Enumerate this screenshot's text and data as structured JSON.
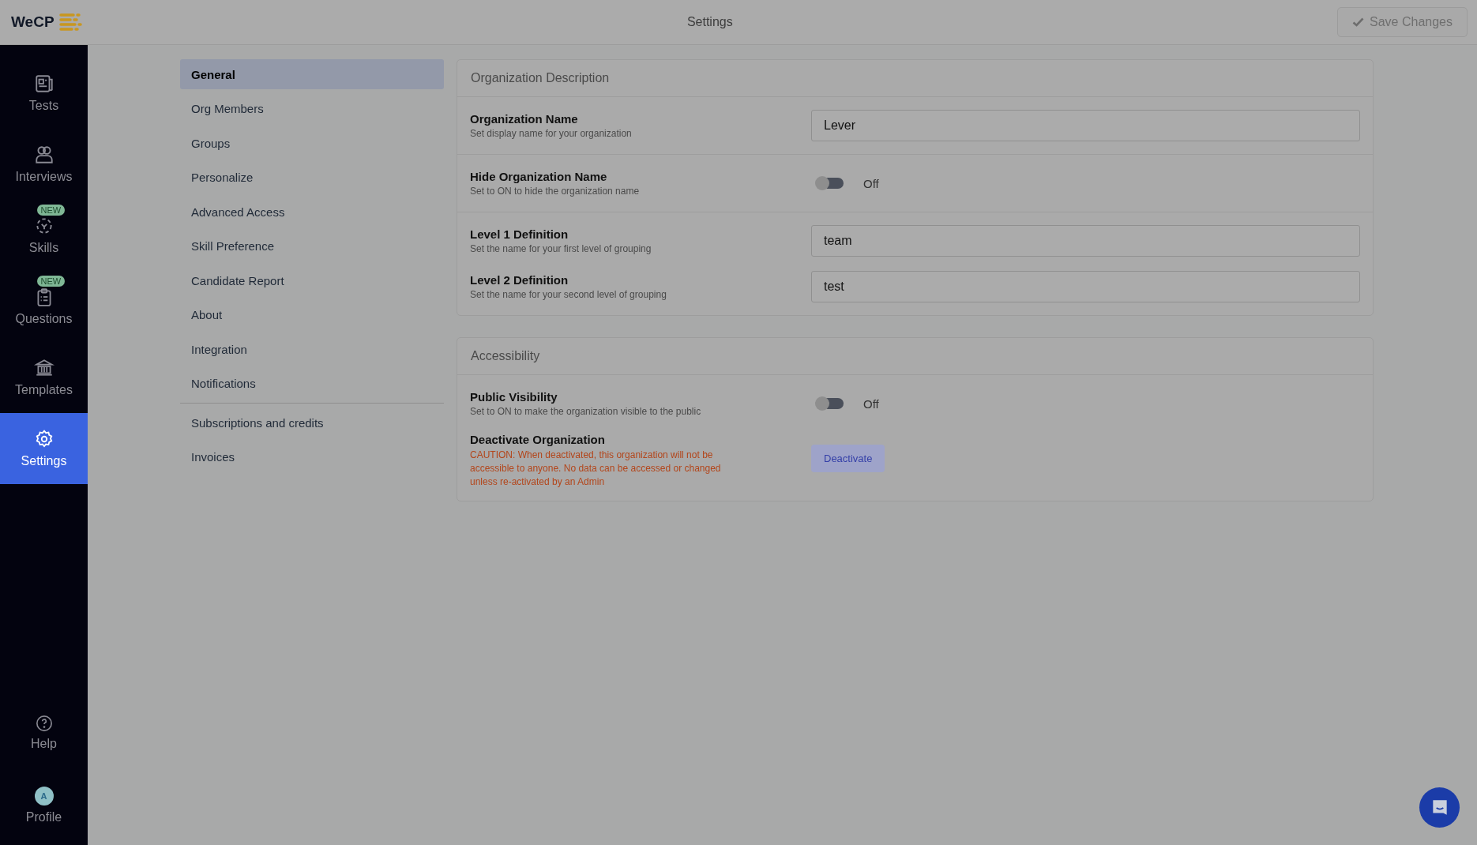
{
  "header": {
    "logo": "WeCP",
    "title": "Settings",
    "save_button": "Save Changes"
  },
  "sidebar": {
    "items": [
      {
        "label": "Tests",
        "selected": false
      },
      {
        "label": "Interviews",
        "selected": false
      },
      {
        "label": "Skills",
        "selected": false,
        "badge": "NEW"
      },
      {
        "label": "Questions",
        "selected": false,
        "badge": "NEW"
      },
      {
        "label": "Templates",
        "selected": false
      },
      {
        "label": "Settings",
        "selected": true
      }
    ],
    "bottom": [
      {
        "label": "Help"
      },
      {
        "label": "Profile",
        "initial": "A"
      }
    ]
  },
  "settings_menu": {
    "groups": [
      [
        {
          "label": "General",
          "selected": true
        },
        {
          "label": "Org Members",
          "selected": false
        },
        {
          "label": "Groups",
          "selected": false
        },
        {
          "label": "Personalize",
          "selected": false
        },
        {
          "label": "Advanced Access",
          "selected": false
        },
        {
          "label": "Skill Preference",
          "selected": false
        },
        {
          "label": "Candidate Report",
          "selected": false
        },
        {
          "label": "About",
          "selected": false
        },
        {
          "label": "Integration",
          "selected": false
        },
        {
          "label": "Notifications",
          "selected": false
        }
      ],
      [
        {
          "label": "Subscriptions and credits",
          "selected": false
        },
        {
          "label": "Invoices",
          "selected": false
        }
      ]
    ]
  },
  "sections": [
    {
      "title": "Organization Description",
      "groups": [
        [
          {
            "kind": "input",
            "label": "Organization Name",
            "hint": "Set display name for your organization",
            "value": "Lever"
          }
        ],
        [
          {
            "kind": "toggle",
            "label": "Hide Organization Name",
            "hint": "Set to ON to hide the organization name",
            "on": false,
            "state_text": "Off"
          }
        ],
        [
          {
            "kind": "input",
            "label": "Level 1 Definition",
            "hint": "Set the name for your first level of grouping",
            "value": "team"
          },
          {
            "kind": "input",
            "label": "Level 2 Definition",
            "hint": "Set the name for your second level of grouping",
            "value": "test"
          }
        ]
      ]
    },
    {
      "title": "Accessibility",
      "groups": [
        [
          {
            "kind": "toggle",
            "label": "Public Visibility",
            "hint": "Set to ON to make the organization visible to the public",
            "on": false,
            "state_text": "Off"
          },
          {
            "kind": "button",
            "label": "Deactivate Organization",
            "warning": "CAUTION: When deactivated, this organization will not be accessible to anyone. No data can be accessed or changed unless re-activated by an Admin",
            "button": "Deactivate"
          }
        ]
      ]
    }
  ]
}
